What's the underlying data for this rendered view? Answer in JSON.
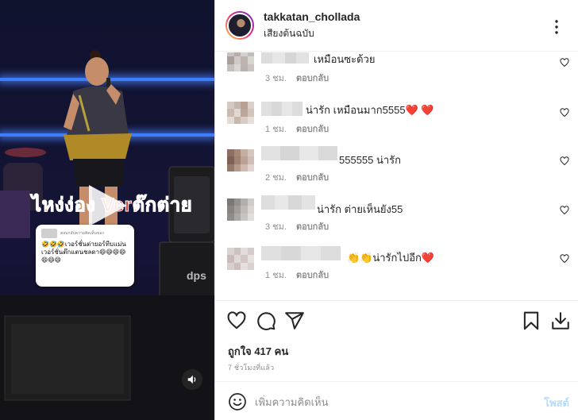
{
  "post": {
    "username": "takkatan_chollada",
    "audio_label": "เสียงต้นฉบับ",
    "likes_text": "ถูกใจ 417 คน",
    "time_text": "7 ชั่วโมงที่แล้ว"
  },
  "video": {
    "caption": "ไหง่ง่อง Verต๊กต่าย",
    "sticker": {
      "title": "ตอบกลับความคิดเห็นของ",
      "text": "🤣🤣🤣เวอร์ชั่นต่ายอร์ทีบแม่นเวอร์ชั่นต๊กแตนชลดา😄😄😄😄😄😄😄"
    }
  },
  "comments": [
    {
      "text": "เหมือนซะด้วย",
      "time": "3 ชม.",
      "reply": "ตอบกลับ"
    },
    {
      "text": "น่ารัก เหมือนมาก5555❤️ ❤️",
      "time": "1 ชม.",
      "reply": "ตอบกลับ"
    },
    {
      "text": "555555 น่ารัก",
      "time": "2 ชม.",
      "reply": "ตอบกลับ"
    },
    {
      "text": "น่ารัก ต่ายเห็นยัง55",
      "time": "3 ชม.",
      "reply": "ตอบกลับ"
    },
    {
      "text": "👏👏น่ารักไปอีก❤️",
      "time": "1 ชม.",
      "reply": "ตอบกลับ"
    }
  ],
  "input": {
    "placeholder": "เพิ่มความคิดเห็น",
    "post_label": "โพสต์"
  },
  "colors": {
    "accent_disabled": "#b3dbff",
    "muted_text": "#8e8e8e",
    "heart": "#e0245e"
  }
}
